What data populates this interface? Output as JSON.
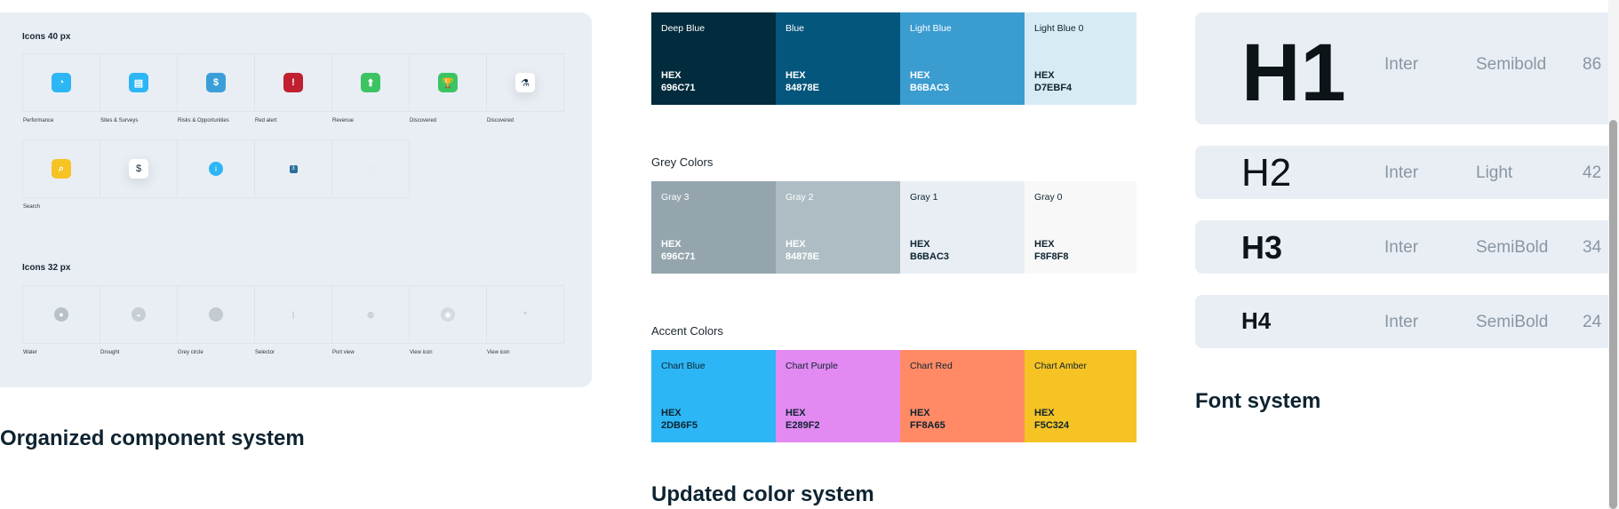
{
  "components": {
    "title": "Organized component system",
    "icons40": {
      "heading": "Icons 40 px",
      "row1": [
        {
          "label": "Performance",
          "icon": "gauge-icon",
          "glyph": "◔",
          "color": "#2DB6F5",
          "style": "filled"
        },
        {
          "label": "Sites & Surveys",
          "icon": "clipboard-icon",
          "glyph": "▤",
          "color": "#2DB6F5",
          "style": "filled"
        },
        {
          "label": "Risks & Opportunities",
          "icon": "dollar-doc-icon",
          "glyph": "$",
          "color": "#3A9FD9",
          "style": "filled"
        },
        {
          "label": "Red alert",
          "icon": "shield-alert-icon",
          "glyph": "!",
          "color": "#C0202F",
          "style": "filled"
        },
        {
          "label": "Revenue",
          "icon": "arrow-up-icon",
          "glyph": "⬆",
          "color": "#3CC462",
          "style": "filled"
        },
        {
          "label": "Discovered",
          "icon": "trophy-icon",
          "glyph": "🏆",
          "color": "#3CC462",
          "style": "filled"
        },
        {
          "label": "Discovered",
          "icon": "flask-icon",
          "glyph": "⚗",
          "color": "#ffffff",
          "style": "white"
        }
      ],
      "row2": [
        {
          "label": "Search",
          "icon": "search-icon",
          "glyph": "⌕",
          "color": "#F5C324",
          "style": "filled"
        },
        {
          "label": "",
          "icon": "money-bag-icon",
          "glyph": "$",
          "color": "#ffffff",
          "style": "white"
        },
        {
          "label": "",
          "icon": "info-icon",
          "glyph": "i",
          "color": "#2DB6F5",
          "style": "round"
        },
        {
          "label": "",
          "icon": "notification-icon",
          "glyph": "3",
          "color": "#2A6F9A",
          "style": "small"
        },
        {
          "label": "",
          "icon": "bell-icon",
          "glyph": "△",
          "color": "#dfe6ee",
          "style": "faint"
        }
      ]
    },
    "icons32": {
      "heading": "Icons 32 px",
      "row": [
        {
          "label": "Water",
          "icon": "water-drop-icon",
          "glyph": "●",
          "color": "#b8c0c8"
        },
        {
          "label": "Drought",
          "icon": "drought-icon",
          "glyph": "◒",
          "color": "#c8ced5"
        },
        {
          "label": "Grey circle",
          "icon": "grey-circle-icon",
          "glyph": "",
          "color": "#c4cad1"
        },
        {
          "label": "Selector",
          "icon": "selector-icon",
          "glyph": "|",
          "color": "transparent"
        },
        {
          "label": "Port view",
          "icon": "globe-icon",
          "glyph": "◍",
          "color": "transparent"
        },
        {
          "label": "View icon",
          "icon": "eye-icon",
          "glyph": "◉",
          "color": "#d3d9e0"
        },
        {
          "label": "View icon",
          "icon": "asterisk-icon",
          "glyph": "*",
          "color": "transparent"
        }
      ]
    }
  },
  "colors": {
    "title": "Updated color system",
    "groups": [
      {
        "label": "",
        "swatches": [
          {
            "name": "Deep Blue",
            "hex_label": "HEX",
            "hex": "696C71",
            "bg": "#022B3D",
            "fg": "#ffffff"
          },
          {
            "name": "Blue",
            "hex_label": "HEX",
            "hex": "84878E",
            "bg": "#04567C",
            "fg": "#ffffff"
          },
          {
            "name": "Light Blue",
            "hex_label": "HEX",
            "hex": "B6BAC3",
            "bg": "#3B9CD0",
            "fg": "#ffffff"
          },
          {
            "name": "Light Blue 0",
            "hex_label": "HEX",
            "hex": "D7EBF4",
            "bg": "#D7EBF4",
            "fg": "#0d2330"
          }
        ]
      },
      {
        "label": "Grey Colors",
        "swatches": [
          {
            "name": "Gray 3",
            "hex_label": "HEX",
            "hex": "696C71",
            "bg": "#94A5AE",
            "fg": "#ffffff"
          },
          {
            "name": "Gray 2",
            "hex_label": "HEX",
            "hex": "84878E",
            "bg": "#ADBDC3",
            "fg": "#ffffff"
          },
          {
            "name": "Gray 1",
            "hex_label": "HEX",
            "hex": "B6BAC3",
            "bg": "#E9EEF5",
            "fg": "#0d2330"
          },
          {
            "name": "Gray 0",
            "hex_label": "HEX",
            "hex": "F8F8F8",
            "bg": "#F8F8F8",
            "fg": "#0d2330"
          }
        ]
      },
      {
        "label": "Accent Colors",
        "swatches": [
          {
            "name": "Chart Blue",
            "hex_label": "HEX",
            "hex": "2DB6F5",
            "bg": "#2DB6F5",
            "fg": "#0d2330"
          },
          {
            "name": "Chart Purple",
            "hex_label": "HEX",
            "hex": "E289F2",
            "bg": "#E289F2",
            "fg": "#0d2330"
          },
          {
            "name": "Chart Red",
            "hex_label": "HEX",
            "hex": "FF8A65",
            "bg": "#FF8A65",
            "fg": "#0d2330"
          },
          {
            "name": "Chart Amber",
            "hex_label": "HEX",
            "hex": "F5C324",
            "bg": "#F5C324",
            "fg": "#0d2330"
          }
        ]
      }
    ]
  },
  "fonts": {
    "title": "Font system",
    "rows": [
      {
        "sample": "H1",
        "family": "Inter",
        "weight": "Semibold",
        "size": "86"
      },
      {
        "sample": "H2",
        "family": "Inter",
        "weight": "Light",
        "size": "42"
      },
      {
        "sample": "H3",
        "family": "Inter",
        "weight": "SemiBold",
        "size": "34"
      },
      {
        "sample": "H4",
        "family": "Inter",
        "weight": "SemiBold",
        "size": "24"
      }
    ]
  }
}
